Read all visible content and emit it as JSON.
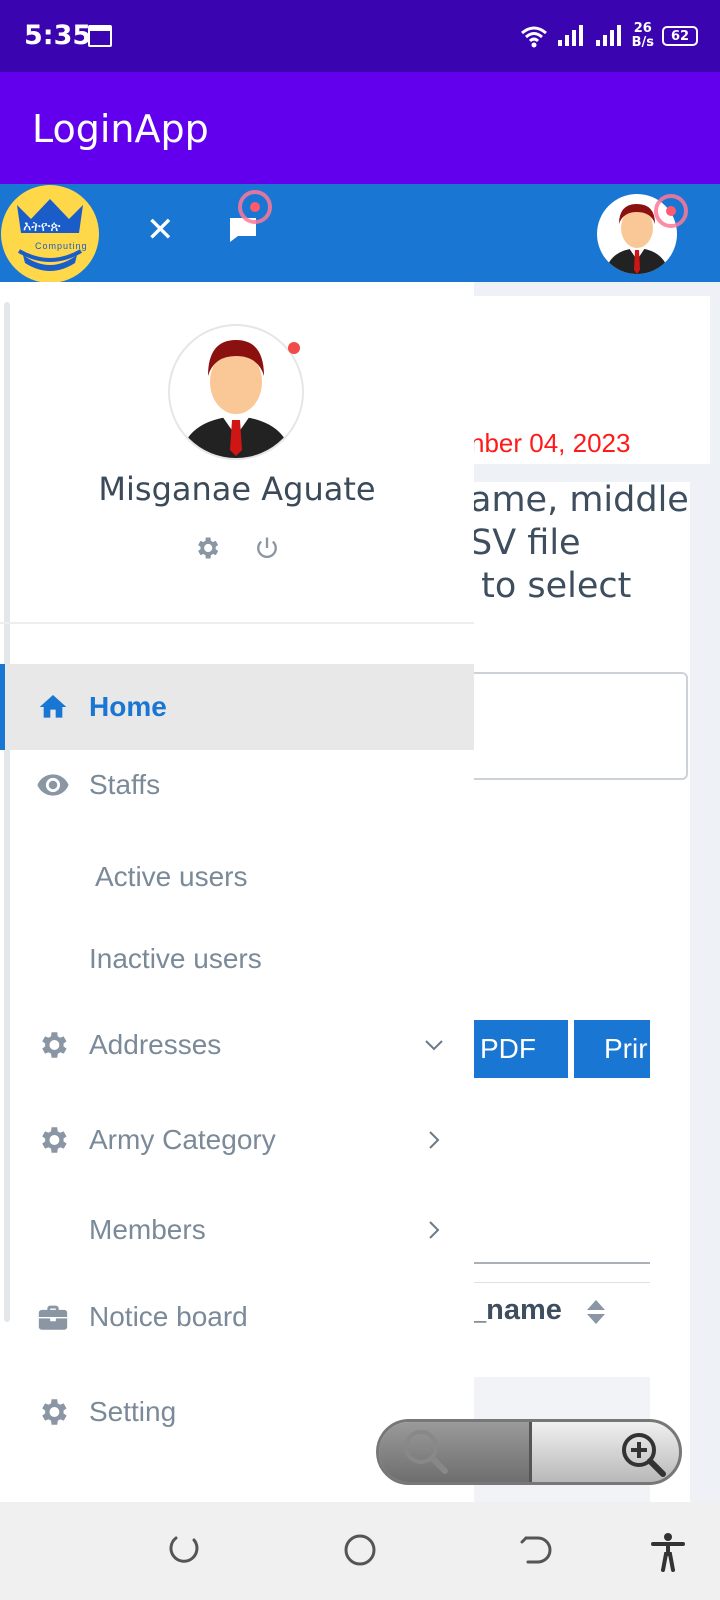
{
  "status_bar": {
    "time": "5:35",
    "net_speed_value": "26",
    "net_speed_unit": "B/s",
    "battery": "62"
  },
  "app_bar": {
    "title": "LoginApp"
  },
  "web_header": {
    "logo_text": "እትዮጵ",
    "logo_sub": "Computing"
  },
  "profile": {
    "name": "Misganae Aguate"
  },
  "nav": {
    "items": [
      {
        "label": "Home",
        "icon": "home-icon",
        "active": true
      },
      {
        "label": "Staffs",
        "icon": "eye-icon"
      },
      {
        "label": "Active users"
      },
      {
        "label": "Inactive users"
      },
      {
        "label": "Addresses",
        "icon": "gear-icon",
        "chevron": "down"
      },
      {
        "label": "Army Category",
        "icon": "gear-icon",
        "chevron": "right"
      },
      {
        "label": "Members",
        "chevron": "right"
      },
      {
        "label": "Notice board",
        "icon": "briefcase-icon"
      },
      {
        "label": "Setting",
        "icon": "gear-icon"
      }
    ]
  },
  "background": {
    "date": "nber 04, 2023",
    "text": "ame, middle\nSV file\n to select",
    "pdf_button": "PDF",
    "print_button": "Prir",
    "column_header": "_name"
  },
  "colors": {
    "status_bar": "#3a05b0",
    "app_bar": "#6200ee",
    "header": "#1976d2",
    "accent": "#1976d2",
    "date_red": "#ff1a1a"
  }
}
